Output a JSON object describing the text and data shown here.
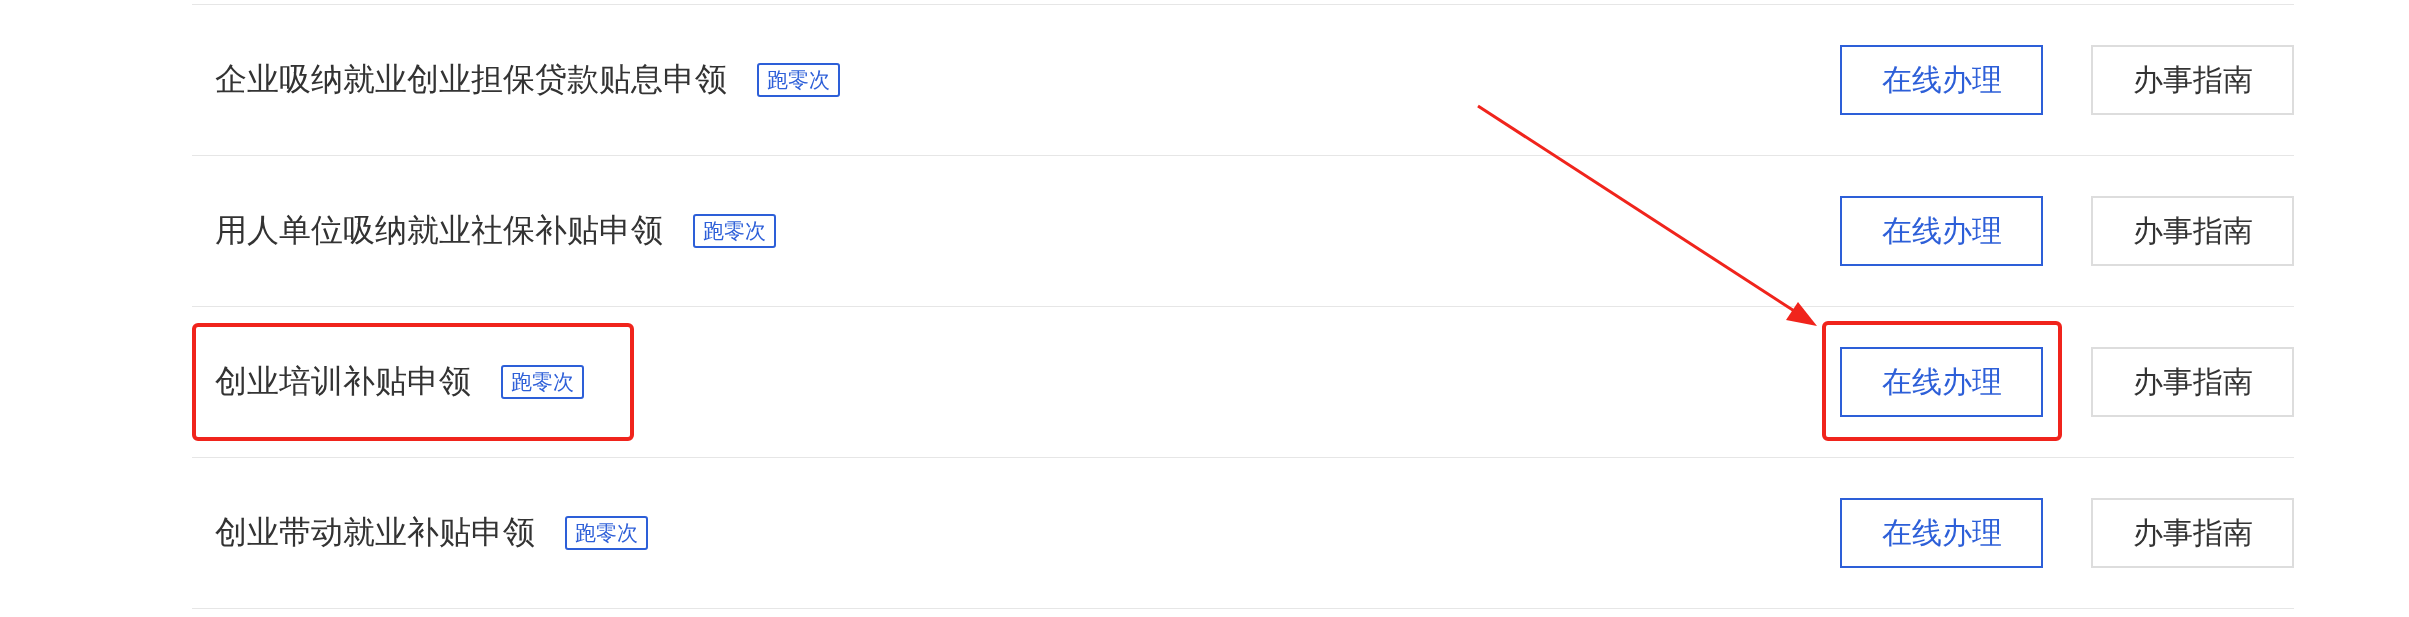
{
  "rows": [
    {
      "title": "企业吸纳就业创业担保贷款贴息申领",
      "badge": "跑零次",
      "primary_button": "在线办理",
      "secondary_button": "办事指南",
      "highlighted": false
    },
    {
      "title": "用人单位吸纳就业社保补贴申领",
      "badge": "跑零次",
      "primary_button": "在线办理",
      "secondary_button": "办事指南",
      "highlighted": false
    },
    {
      "title": "创业培训补贴申领",
      "badge": "跑零次",
      "primary_button": "在线办理",
      "secondary_button": "办事指南",
      "highlighted": true
    },
    {
      "title": "创业带动就业补贴申领",
      "badge": "跑零次",
      "primary_button": "在线办理",
      "secondary_button": "办事指南",
      "highlighted": false
    }
  ]
}
